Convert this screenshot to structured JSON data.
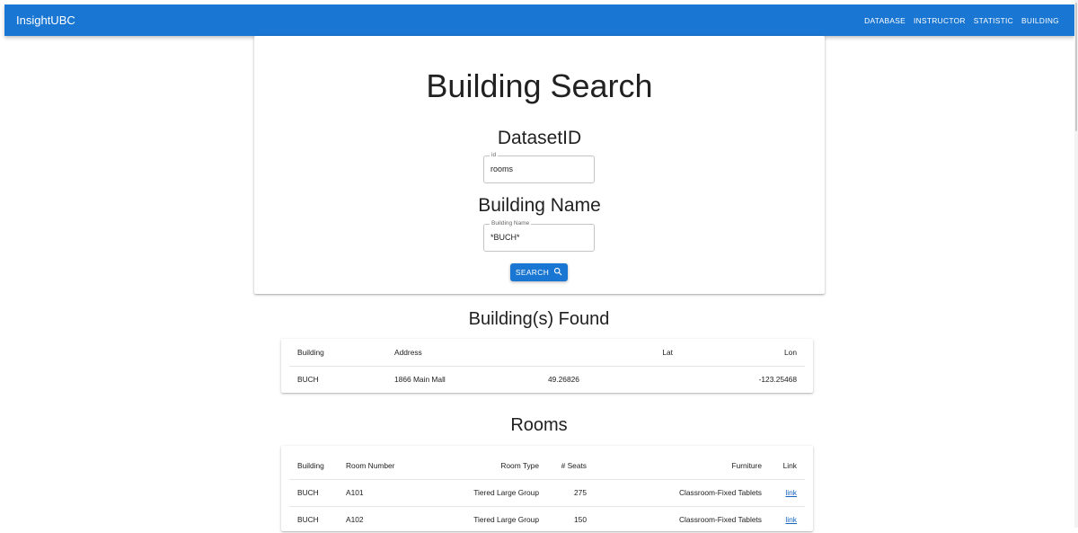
{
  "appbar": {
    "brand": "InsightUBC",
    "nav": [
      "DATABASE",
      "INSTRUCTOR",
      "STATISTIC",
      "BUILDING"
    ]
  },
  "search": {
    "title": "Building Search",
    "dataset_heading": "DatasetID",
    "dataset_label": "id",
    "dataset_value": "rooms",
    "building_heading": "Building Name",
    "building_label": "Building Name",
    "building_value": "*BUCH*",
    "button_label": "SEARCH"
  },
  "buildings": {
    "title": "Building(s) Found",
    "headers": [
      "Building",
      "Address",
      "Lat",
      "Lon"
    ],
    "rows": [
      [
        "BUCH",
        "1866 Main Mall",
        "49.26826",
        "-123.25468"
      ]
    ]
  },
  "rooms": {
    "title": "Rooms",
    "headers": [
      "Building",
      "Room Number",
      "Room Type",
      "# Seats",
      "Furniture",
      "Link"
    ],
    "rows": [
      [
        "BUCH",
        "A101",
        "Tiered Large Group",
        "275",
        "Classroom-Fixed Tablets",
        "link"
      ],
      [
        "BUCH",
        "A102",
        "Tiered Large Group",
        "150",
        "Classroom-Fixed Tablets",
        "link"
      ]
    ]
  },
  "colors": {
    "primary": "#1976d2",
    "link": "#1565c0"
  }
}
